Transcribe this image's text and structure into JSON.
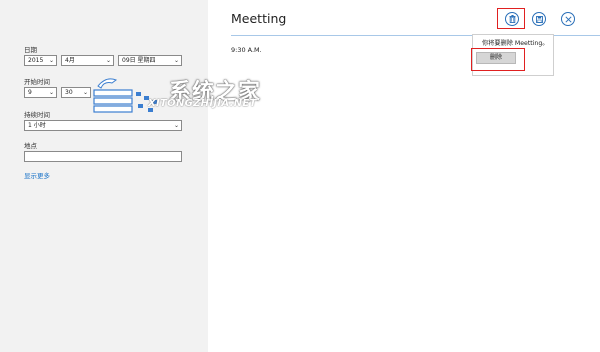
{
  "form": {
    "date_label": "日期",
    "year": "2015",
    "month": "4月",
    "day": "09日 星期四",
    "start_time_label": "开始时间",
    "start_hour": "9",
    "start_minute": "30",
    "duration_label": "持续时间",
    "duration": "1 小时",
    "location_label": "地点",
    "location_value": "",
    "show_more": "显示更多"
  },
  "event": {
    "title": "Meetting",
    "time": "9:30 A.M."
  },
  "toolbar": {
    "delete_icon": "trash-icon",
    "save_icon": "save-icon",
    "close_icon": "close-icon",
    "accent_color": "#2a6fb8",
    "highlight_color": "#e02020"
  },
  "flyout": {
    "message": "你将要删除 Meetting。",
    "delete_button": "删除"
  },
  "watermark": {
    "cn": "系统之家",
    "en": "XITONGZHIJIA.NET"
  }
}
